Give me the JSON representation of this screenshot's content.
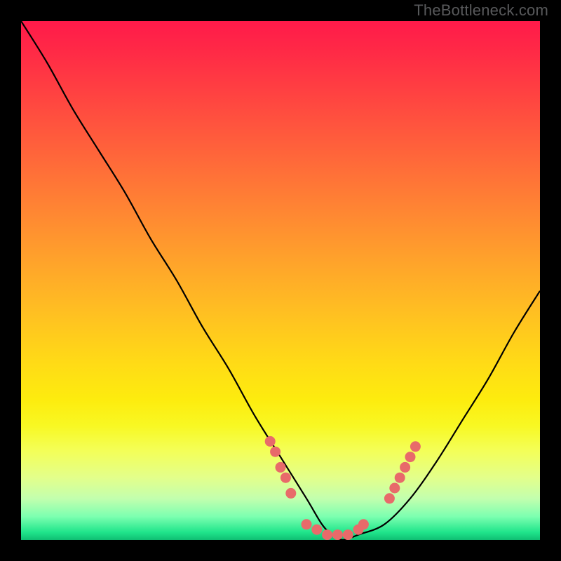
{
  "watermark": "TheBottleneck.com",
  "chart_data": {
    "type": "line",
    "title": "",
    "xlabel": "",
    "ylabel": "",
    "xlim": [
      0,
      100
    ],
    "ylim": [
      0,
      100
    ],
    "grid": false,
    "series": [
      {
        "name": "bottleneck-curve",
        "x": [
          0,
          5,
          10,
          15,
          20,
          25,
          30,
          35,
          40,
          45,
          50,
          55,
          58,
          60,
          62,
          65,
          70,
          75,
          80,
          85,
          90,
          95,
          100
        ],
        "y": [
          100,
          92,
          83,
          75,
          67,
          58,
          50,
          41,
          33,
          24,
          16,
          8,
          3,
          1,
          0,
          1,
          3,
          8,
          15,
          23,
          31,
          40,
          48
        ]
      }
    ],
    "scatter_markers": {
      "name": "highlight-points",
      "points": [
        {
          "x": 48,
          "y": 19
        },
        {
          "x": 49,
          "y": 17
        },
        {
          "x": 50,
          "y": 14
        },
        {
          "x": 51,
          "y": 12
        },
        {
          "x": 52,
          "y": 9
        },
        {
          "x": 55,
          "y": 3
        },
        {
          "x": 57,
          "y": 2
        },
        {
          "x": 59,
          "y": 1
        },
        {
          "x": 61,
          "y": 1
        },
        {
          "x": 63,
          "y": 1
        },
        {
          "x": 65,
          "y": 2
        },
        {
          "x": 66,
          "y": 3
        },
        {
          "x": 71,
          "y": 8
        },
        {
          "x": 72,
          "y": 10
        },
        {
          "x": 73,
          "y": 12
        },
        {
          "x": 74,
          "y": 14
        },
        {
          "x": 75,
          "y": 16
        },
        {
          "x": 76,
          "y": 18
        }
      ]
    },
    "background_gradient": {
      "type": "vertical",
      "stops": [
        {
          "offset": 0.0,
          "color": "#ff1a4a"
        },
        {
          "offset": 0.06,
          "color": "#ff2a46"
        },
        {
          "offset": 0.16,
          "color": "#ff4840"
        },
        {
          "offset": 0.26,
          "color": "#ff663a"
        },
        {
          "offset": 0.36,
          "color": "#ff8433"
        },
        {
          "offset": 0.46,
          "color": "#ffa22b"
        },
        {
          "offset": 0.56,
          "color": "#ffbf22"
        },
        {
          "offset": 0.66,
          "color": "#ffdb16"
        },
        {
          "offset": 0.73,
          "color": "#fdec0e"
        },
        {
          "offset": 0.78,
          "color": "#f8f823"
        },
        {
          "offset": 0.83,
          "color": "#f3ff5a"
        },
        {
          "offset": 0.88,
          "color": "#e3ff8b"
        },
        {
          "offset": 0.92,
          "color": "#c3ffae"
        },
        {
          "offset": 0.955,
          "color": "#7cffb0"
        },
        {
          "offset": 0.985,
          "color": "#20e58b"
        },
        {
          "offset": 1.0,
          "color": "#0fbf73"
        }
      ]
    }
  }
}
